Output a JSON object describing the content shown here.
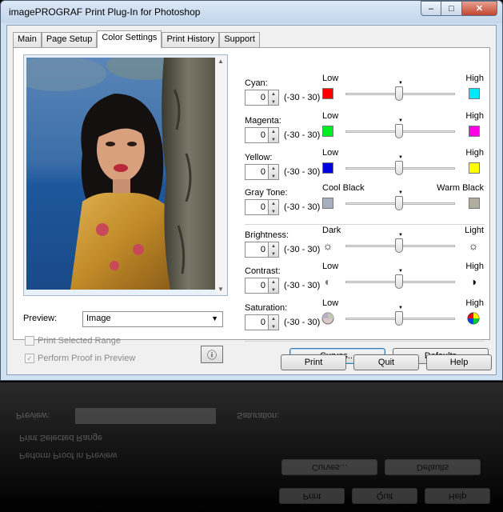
{
  "window": {
    "title": "imagePROGRAF Print Plug-In for Photoshop",
    "minimize": "–",
    "maximize": "□",
    "close": "✕"
  },
  "tabs": [
    "Main",
    "Page Setup",
    "Color Settings",
    "Print History",
    "Support"
  ],
  "active_tab": "Color Settings",
  "preview": {
    "label": "Preview:",
    "selected": "Image",
    "print_selected_range": "Print Selected Range",
    "perform_proof": "Perform Proof in Preview",
    "perform_proof_checked": true,
    "print_selected_range_checked": false
  },
  "adjustments": [
    {
      "name": "Cyan:",
      "value": "0",
      "range": "(-30 - 30)",
      "low": "Low",
      "high": "High",
      "low_color": "#ff0000",
      "high_color": "#00e8ff",
      "position": 0.5
    },
    {
      "name": "Magenta:",
      "value": "0",
      "range": "(-30 - 30)",
      "low": "Low",
      "high": "High",
      "low_color": "#00ee22",
      "high_color": "#ff00e0",
      "position": 0.5
    },
    {
      "name": "Yellow:",
      "value": "0",
      "range": "(-30 - 30)",
      "low": "Low",
      "high": "High",
      "low_color": "#0000e0",
      "high_color": "#ffff00",
      "position": 0.5
    },
    {
      "name": "Gray Tone:",
      "value": "0",
      "range": "(-30 - 30)",
      "low": "Cool Black",
      "high": "Warm Black",
      "low_color": "#a8b0c0",
      "high_color": "#b0ad9e",
      "position": 0.5
    },
    {
      "name": "Brightness:",
      "value": "0",
      "range": "(-30 - 30)",
      "low": "Dark",
      "high": "Light",
      "low_icon": "sun-outline-icon",
      "high_icon": "sun-outline-icon",
      "position": 0.5
    },
    {
      "name": "Contrast:",
      "value": "0",
      "range": "(-30 - 30)",
      "low": "Low",
      "high": "High",
      "low_icon": "half-circle-icon",
      "high_icon": "half-circle-icon",
      "position": 0.5
    },
    {
      "name": "Saturation:",
      "value": "0",
      "range": "(-30 - 30)",
      "low": "Low",
      "high": "High",
      "low_icon": "color-wheel-icon",
      "high_icon": "color-wheel-icon",
      "position": 0.5
    }
  ],
  "buttons": {
    "curves": "Curves...",
    "defaults": "Defaults",
    "print": "Print",
    "quit": "Quit",
    "help": "Help"
  }
}
